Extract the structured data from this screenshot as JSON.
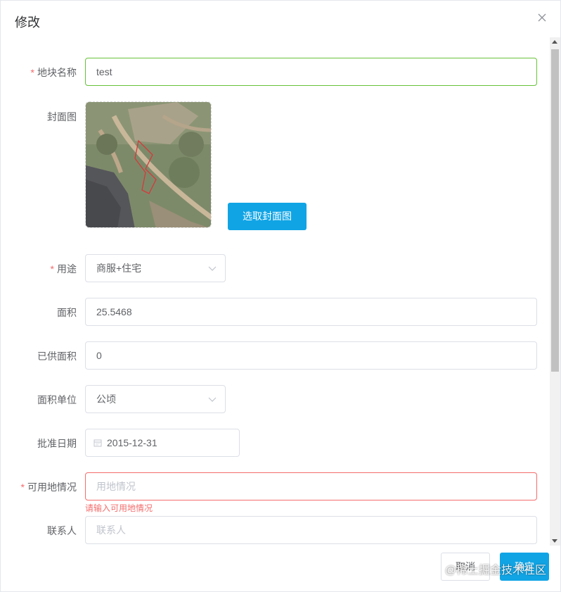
{
  "dialog": {
    "title": "修改"
  },
  "form": {
    "plot_name": {
      "label": "地块名称",
      "value": "test"
    },
    "cover": {
      "label": "封面图",
      "button": "选取封面图"
    },
    "usage": {
      "label": "用途",
      "value": "商服+住宅"
    },
    "area": {
      "label": "面积",
      "value": "25.5468"
    },
    "supplied_area": {
      "label": "已供面积",
      "value": "0"
    },
    "area_unit": {
      "label": "面积单位",
      "value": "公顷"
    },
    "approval_date": {
      "label": "批准日期",
      "value": "2015-12-31"
    },
    "land_status": {
      "label": "可用地情况",
      "placeholder": "用地情况",
      "error": "请输入可用地情况"
    },
    "contact": {
      "label": "联系人",
      "placeholder": "联系人"
    }
  },
  "footer": {
    "cancel": "取消",
    "confirm": "确定"
  },
  "watermark": "@稀土掘金技术社区",
  "colors": {
    "primary": "#10a4e5",
    "error": "#f56c6c",
    "success_border": "#67c23a"
  }
}
